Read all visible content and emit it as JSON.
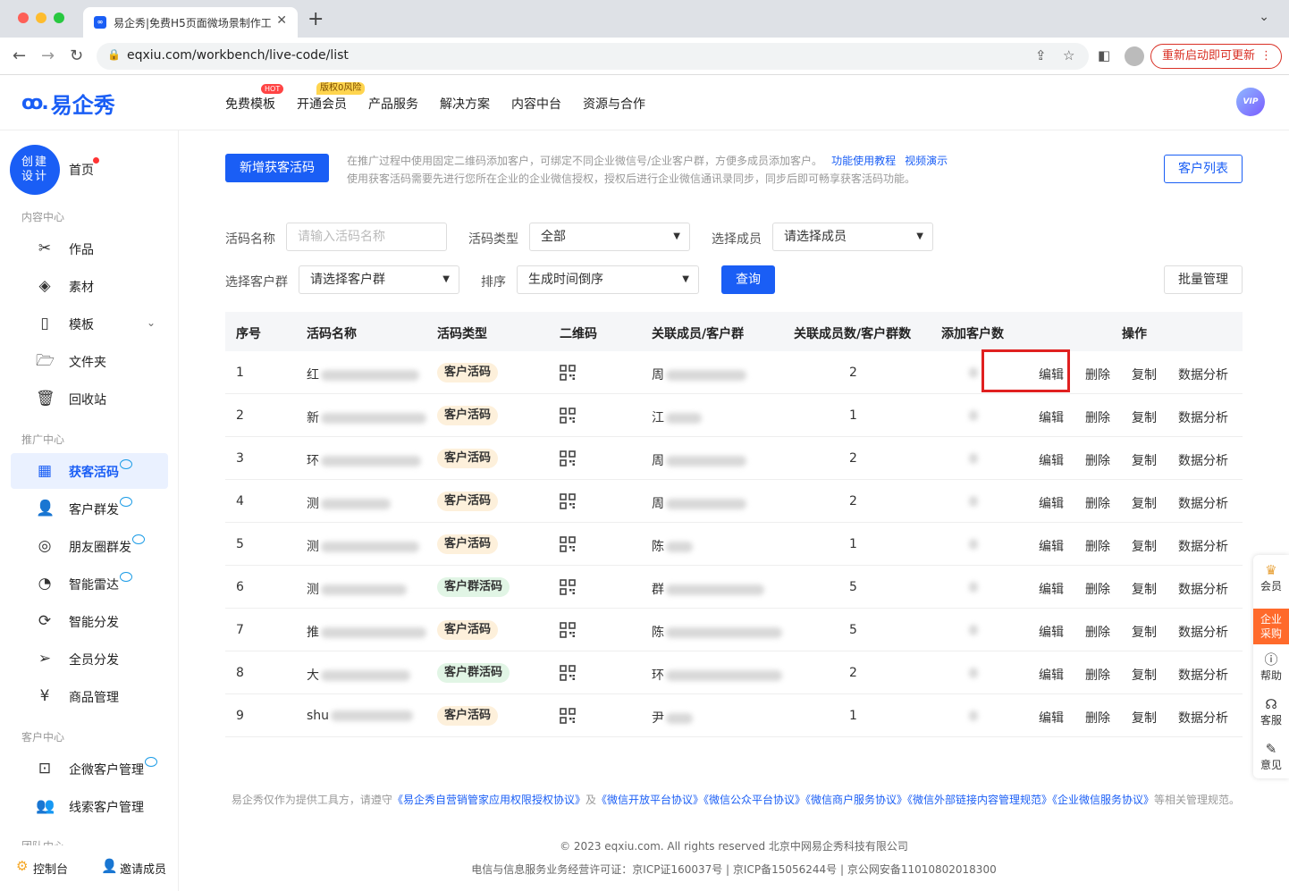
{
  "browser": {
    "tab_title": "易企秀|免费H5页面微场景制作工具",
    "tab_close": "✕",
    "new_tab": "+",
    "url": "eqxiu.com/workbench/live-code/list",
    "restart_label": "重新启动即可更新"
  },
  "header": {
    "logo_text": "易企秀",
    "nav": [
      "免费模板",
      "开通会员",
      "产品服务",
      "解决方案",
      "内容中台",
      "资源与合作"
    ],
    "hot_badge": "HOT",
    "zero_badge": "版权0风险",
    "vip_label": "VIP"
  },
  "sidebar": {
    "create_line1": "创建",
    "create_line2": "设计",
    "home": "首页",
    "sections": [
      "内容中心",
      "推广中心",
      "客户中心",
      "团队中心"
    ],
    "content_items": [
      "作品",
      "素材",
      "模板",
      "文件夹",
      "回收站"
    ],
    "promo_items": [
      "获客活码",
      "客户群发",
      "朋友圈群发",
      "智能雷达",
      "智能分发",
      "全员分发",
      "商品管理"
    ],
    "customer_items": [
      "企微客户管理",
      "线索客户管理"
    ],
    "bottom_console": "控制台",
    "bottom_invite": "邀请成员"
  },
  "main": {
    "add_button": "新增获客活码",
    "tip_line1": "在推广过程中使用固定二维码添加客户，可绑定不同企业微信号/企业客户群，方便多成员添加客户。",
    "tip_link1": "功能使用教程",
    "tip_link2": "视频演示",
    "tip_line2": "使用获客活码需要先进行您所在企业的企业微信授权，授权后进行企业微信通讯录同步，同步后即可畅享获客活码功能。",
    "customer_list_button": "客户列表",
    "filters": {
      "name_label": "活码名称",
      "name_placeholder": "请输入活码名称",
      "type_label": "活码类型",
      "type_value": "全部",
      "member_label": "选择成员",
      "member_value": "请选择成员",
      "group_label": "选择客户群",
      "group_value": "请选择客户群",
      "sort_label": "排序",
      "sort_value": "生成时间倒序",
      "query_button": "查询",
      "batch_button": "批量管理"
    },
    "table": {
      "headers": [
        "序号",
        "活码名称",
        "活码类型",
        "二维码",
        "关联成员/客户群",
        "关联成员数/客户群数",
        "添加客户数",
        "操作"
      ],
      "actions": [
        "编辑",
        "删除",
        "复制",
        "数据分析"
      ],
      "rows": [
        {
          "no": "1",
          "name": "红",
          "type": "客户活码",
          "member": "周",
          "count": "2"
        },
        {
          "no": "2",
          "name": "新",
          "type": "客户活码",
          "member": "江",
          "count": "1"
        },
        {
          "no": "3",
          "name": "环",
          "type": "客户活码",
          "member": "周",
          "count": "2"
        },
        {
          "no": "4",
          "name": "测",
          "type": "客户活码",
          "member": "周",
          "count": "2"
        },
        {
          "no": "5",
          "name": "测",
          "type": "客户活码",
          "member": "陈",
          "count": "1"
        },
        {
          "no": "6",
          "name": "测",
          "type": "客户群活码",
          "member": "群",
          "count": "5"
        },
        {
          "no": "7",
          "name": "推",
          "type": "客户活码",
          "member": "陈",
          "count": "5"
        },
        {
          "no": "8",
          "name": "大",
          "type": "客户群活码",
          "member": "环",
          "count": "2"
        },
        {
          "no": "9",
          "name": "shu",
          "type": "客户活码",
          "member": "尹",
          "count": "1"
        }
      ]
    },
    "footer": {
      "pre": "易企秀仅作为提供工具方，请遵守",
      "links": [
        "《易企秀自营销管家应用权限授权协议》",
        "《微信开放平台协议》",
        "《微信公众平台协议》",
        "《微信商户服务协议》",
        "《微信外部链接内容管理规范》",
        "《企业微信服务协议》"
      ],
      "and": "及",
      "post": "等相关管理规范。",
      "copyright": "© 2023 eqxiu.com. All rights reserved 北京中网易企秀科技有限公司",
      "license": "电信与信息服务业务经营许可证：京ICP证160037号 | 京ICP备15056244号 | 京公网安备11010802018300"
    }
  },
  "float_panel": {
    "member": "会员",
    "enterprise_line1": "企业",
    "enterprise_line2": "采购",
    "help": "帮助",
    "service": "客服",
    "feedback": "意见"
  }
}
